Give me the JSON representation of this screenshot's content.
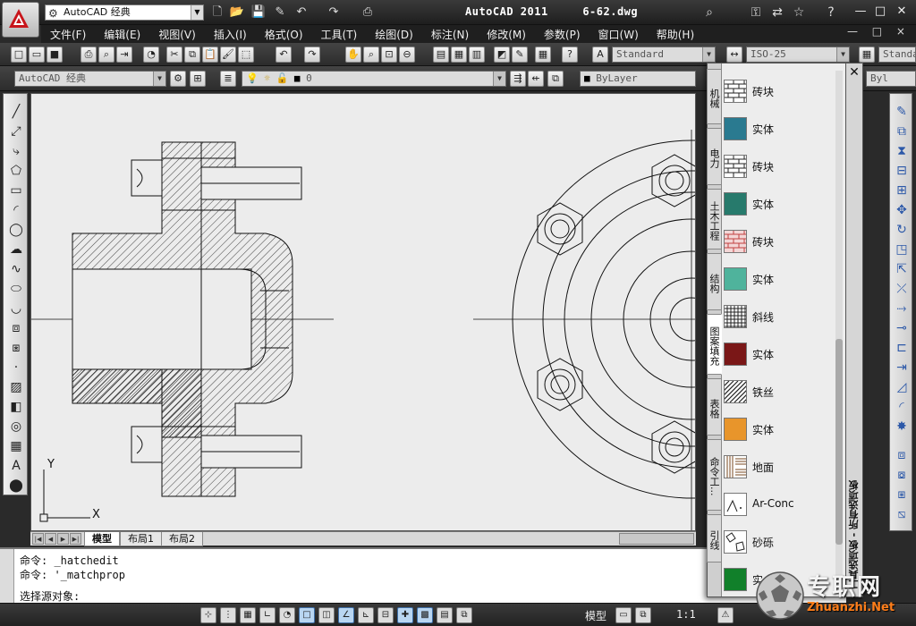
{
  "app": {
    "title": "AutoCAD 2011     6-62.dwg",
    "workspace": "AutoCAD 经典",
    "window_controls": "— □ ×"
  },
  "menu": [
    "文件(F)",
    "编辑(E)",
    "视图(V)",
    "插入(I)",
    "格式(O)",
    "工具(T)",
    "绘图(D)",
    "标注(N)",
    "修改(M)",
    "参数(P)",
    "窗口(W)",
    "帮助(H)"
  ],
  "styles": {
    "text_style": "Standard",
    "dim_style": "ISO-25",
    "table_style": "Standa"
  },
  "workspace_toolbar": "AutoCAD 经典",
  "layer": {
    "current": "0"
  },
  "properties": {
    "color": "ByLayer",
    "linetype": "Byl"
  },
  "layout_tabs": [
    "模型",
    "布局1",
    "布局2"
  ],
  "command_lines": [
    "命令: _hatchedit",
    "命令: '_matchprop",
    "选择源对象:"
  ],
  "status": {
    "space": "模型",
    "scale": "1:1"
  },
  "palette": {
    "title": "工具选项板 - 所有选项板",
    "tabs": [
      "机械",
      "电力",
      "土木工程",
      "结构",
      "图案填充",
      "表格",
      "命令工...",
      "引线"
    ],
    "active_tab": "图案填充",
    "items": [
      {
        "label": "砖块",
        "pattern": "brick",
        "color": "#ffffff"
      },
      {
        "label": "实体",
        "pattern": "solid",
        "color": "#2a7a90"
      },
      {
        "label": "砖块",
        "pattern": "brick",
        "color": "#ffffff"
      },
      {
        "label": "实体",
        "pattern": "solid",
        "color": "#277a6c"
      },
      {
        "label": "砖块",
        "pattern": "brick-red",
        "color": "#f3d6d6"
      },
      {
        "label": "实体",
        "pattern": "solid",
        "color": "#4fb39c"
      },
      {
        "label": "斜线",
        "pattern": "grid",
        "color": "#ffffff"
      },
      {
        "label": "实体",
        "pattern": "solid",
        "color": "#7a1717"
      },
      {
        "label": "铁丝",
        "pattern": "diag",
        "color": "#ffffff"
      },
      {
        "label": "实体",
        "pattern": "solid",
        "color": "#e8952b"
      },
      {
        "label": "地面",
        "pattern": "parquet",
        "color": "#ffffff"
      },
      {
        "label": "Ar-Conc",
        "pattern": "conc",
        "color": "#ffffff"
      },
      {
        "label": "砂砾",
        "pattern": "gravel",
        "color": "#ffffff"
      },
      {
        "label": "实",
        "pattern": "solid",
        "color": "#11802a"
      }
    ]
  },
  "watermark": {
    "brand": "专职网",
    "site": "Zhuanzhi.Net"
  },
  "colors": {
    "chrome": "#2a2a2a",
    "canvas": "#ececec"
  }
}
